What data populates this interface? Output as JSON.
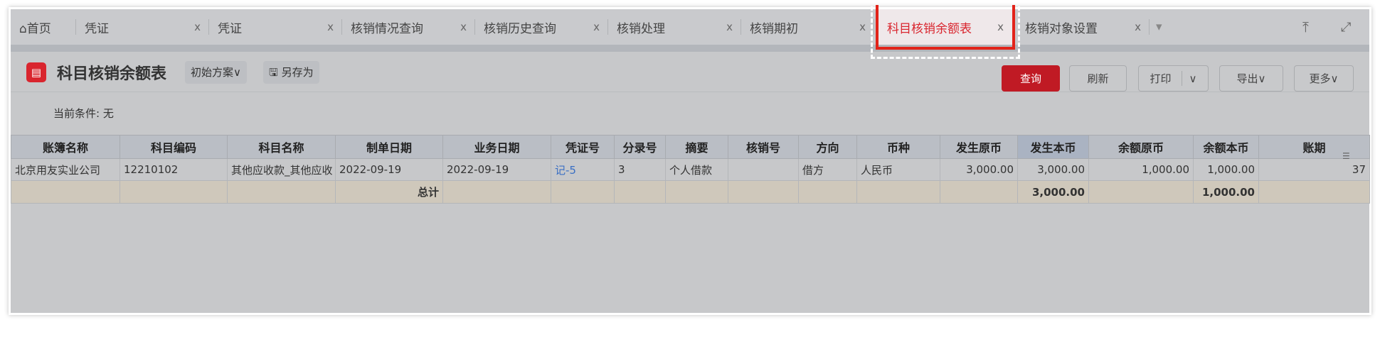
{
  "tabs": [
    {
      "label": "首页",
      "icon": "home-icon"
    },
    {
      "label": "凭证",
      "close": "x"
    },
    {
      "label": "凭证",
      "close": "x"
    },
    {
      "label": "核销情况查询",
      "close": "x"
    },
    {
      "label": "核销历史查询",
      "close": "x"
    },
    {
      "label": "核销处理",
      "close": "x"
    },
    {
      "label": "核销期初",
      "close": "x"
    },
    {
      "label": "科目核销余额表",
      "close": "x",
      "active": true
    },
    {
      "label": "核销对象设置",
      "close": "x"
    }
  ],
  "tab_more": "▾",
  "toolbar": {
    "title": "科目核销余额表",
    "scheme": "初始方案∨",
    "save_as": "另存为",
    "query": "查询",
    "refresh": "刷新",
    "print": "打印",
    "print_more": "∨",
    "export": "导出∨",
    "more": "更多∨"
  },
  "condition": {
    "label": "当前条件:",
    "value": "无"
  },
  "table": {
    "headers": [
      "账簿名称",
      "科目编码",
      "科目名称",
      "制单日期",
      "业务日期",
      "凭证号",
      "分录号",
      "摘要",
      "核销号",
      "方向",
      "币种",
      "发生原币",
      "发生本币",
      "余额原币",
      "余额本币",
      "账期"
    ],
    "rows": [
      [
        "北京用友实业公司",
        "12210102",
        "其他应收款_其他应收",
        "2022-09-19",
        "2022-09-19",
        "记-5",
        "3",
        "个人借款",
        "",
        "借方",
        "人民币",
        "3,000.00",
        "3,000.00",
        "1,000.00",
        "1,000.00",
        "37"
      ]
    ],
    "total": {
      "label": "总计",
      "amount_local": "3,000.00",
      "balance_local": "1,000.00"
    }
  },
  "colors": {
    "accent": "#c01a24",
    "link": "#3a6fc4"
  }
}
